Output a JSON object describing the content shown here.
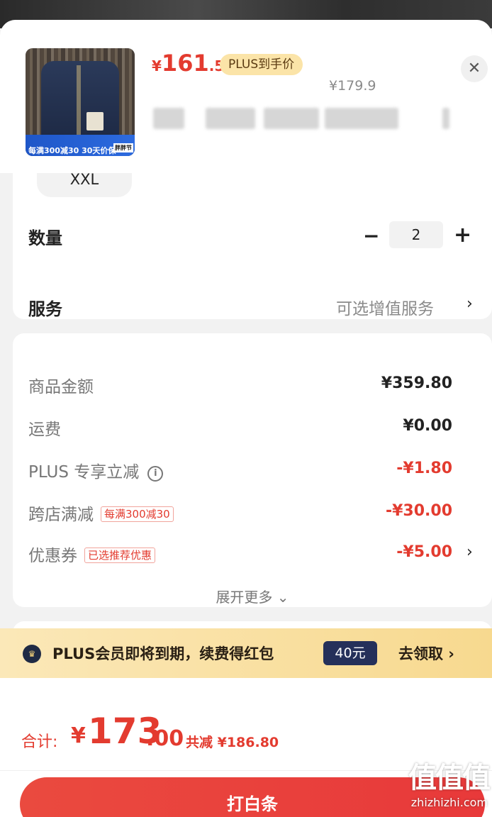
{
  "product": {
    "price_currency": "¥",
    "price_int": "161",
    "price_dec": ".5",
    "plus_label": "PLUS到手价",
    "original_price": "¥179.9",
    "thumb_promo": "每满300减30  30天价保",
    "thumb_tag": "胖胖节"
  },
  "close_icon": "✕",
  "options": {
    "size_value": "XXL",
    "quantity_label": "数量",
    "quantity_value": "2",
    "minus": "−",
    "plus": "+",
    "service_label": "服务",
    "service_value": "可选增值服务",
    "chevron": "›"
  },
  "fees": {
    "goods_label": "商品金额",
    "goods_value": "¥359.80",
    "shipping_label": "运费",
    "shipping_value": "¥0.00",
    "plus_discount_label": "PLUS 专享立减",
    "plus_discount_value": "-¥1.80",
    "cross_label": "跨店满减",
    "cross_tag": "每满300减30",
    "cross_value": "-¥30.00",
    "coupon_label": "优惠券",
    "coupon_tag": "已选推荐优惠",
    "coupon_value": "-¥5.00",
    "expand_label": "展开更多 ⌄"
  },
  "banner": {
    "text": "PLUS会员即将到期，续费得红包",
    "badge": "40元",
    "action": "去领取 ›"
  },
  "footer": {
    "total_label": "合计:",
    "total_currency": "¥",
    "total_int": "173",
    "total_dec": ".00",
    "saved": "共减 ¥186.80",
    "pay_button": "打白条"
  },
  "watermark": {
    "logo_text": "值值值",
    "url": "zhizhizhi.com"
  },
  "colors": {
    "accent_red": "#e33b2f",
    "plus_gold": "#fbe4a8",
    "badge_navy": "#25305a"
  }
}
